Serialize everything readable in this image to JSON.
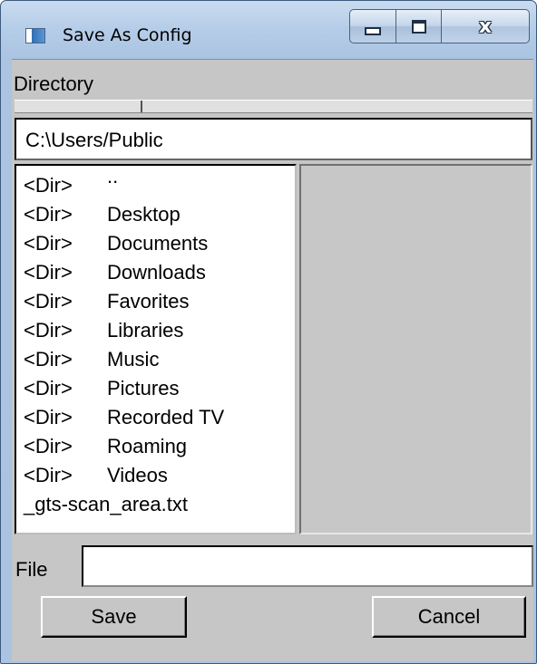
{
  "window": {
    "title": "Save As Config",
    "controls": {
      "close_glyph": "x"
    }
  },
  "directory": {
    "label": "Directory",
    "path": "C:\\Users/Public"
  },
  "file_list": [
    {
      "tag": "<Dir>",
      "name": ".."
    },
    {
      "tag": "<Dir>",
      "name": "Desktop"
    },
    {
      "tag": "<Dir>",
      "name": "Documents"
    },
    {
      "tag": "<Dir>",
      "name": "Downloads"
    },
    {
      "tag": "<Dir>",
      "name": "Favorites"
    },
    {
      "tag": "<Dir>",
      "name": "Libraries"
    },
    {
      "tag": "<Dir>",
      "name": "Music"
    },
    {
      "tag": "<Dir>",
      "name": "Pictures"
    },
    {
      "tag": "<Dir>",
      "name": "Recorded TV"
    },
    {
      "tag": "<Dir>",
      "name": "Roaming"
    },
    {
      "tag": "<Dir>",
      "name": "Videos"
    },
    {
      "tag": "",
      "name": "_gts-scan_area.txt"
    }
  ],
  "file": {
    "label": "File",
    "value": ""
  },
  "buttons": {
    "save": "Save",
    "cancel": "Cancel"
  },
  "colors": {
    "panel_gray": "#c6c6c6",
    "titlebar_blue": "#b6cde8"
  }
}
